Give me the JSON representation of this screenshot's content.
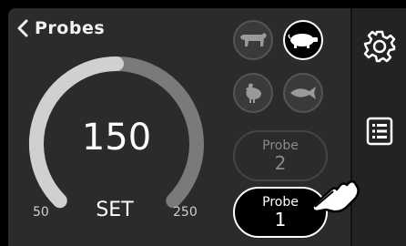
{
  "header": {
    "back_label": "Probes"
  },
  "gauge": {
    "value": "150",
    "set_label": "SET",
    "min": "50",
    "max": "250",
    "min_value": 50,
    "max_value": 250,
    "current": 150
  },
  "food_icons": [
    "cow-icon",
    "pig-icon",
    "chicken-icon",
    "fish-icon"
  ],
  "food_selected": "pig",
  "probes": [
    {
      "title": "Probe",
      "number": "2",
      "active": false
    },
    {
      "title": "Probe",
      "number": "1",
      "active": true
    }
  ],
  "sidebar": {
    "icons": [
      "gear-icon",
      "list-icon"
    ]
  },
  "colors": {
    "background": "#2b2b2b",
    "arc_track": "#7a7a7a",
    "arc_fill": "#d0d0d0",
    "selected_fill": "#000000",
    "accent": "#ffffff"
  }
}
